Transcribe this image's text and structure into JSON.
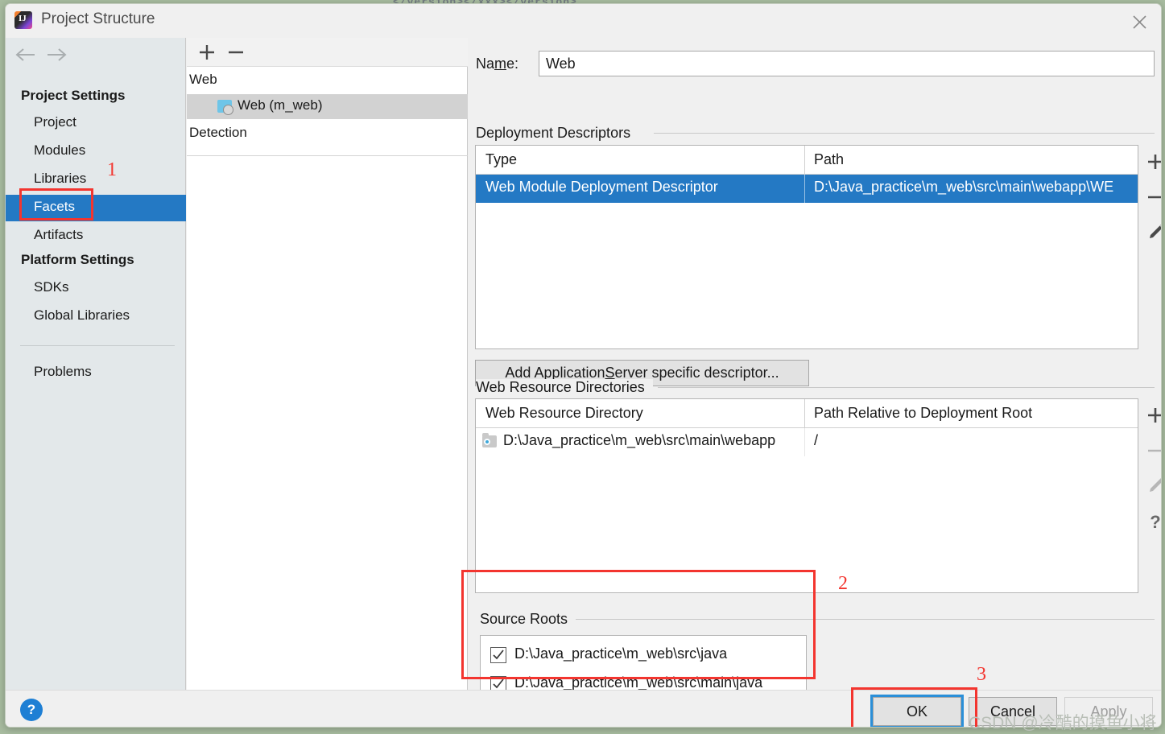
{
  "backdrop": {
    "code_fragment": "</version></xxx></version>"
  },
  "titlebar": {
    "title": "Project Structure",
    "app_icon": "intellij-idea-icon",
    "app_icon_letters": "IJ",
    "close_icon": "close-icon"
  },
  "sidebar": {
    "back_icon": "arrow-left-icon",
    "forward_icon": "arrow-right-icon",
    "groups": [
      {
        "label": "Project Settings"
      },
      {
        "label": "Platform Settings"
      }
    ],
    "items": [
      {
        "label": "Project",
        "selected": false
      },
      {
        "label": "Modules",
        "selected": false
      },
      {
        "label": "Libraries",
        "selected": false
      },
      {
        "label": "Facets",
        "selected": true
      },
      {
        "label": "Artifacts",
        "selected": false
      },
      {
        "label": "SDKs",
        "selected": false
      },
      {
        "label": "Global Libraries",
        "selected": false
      },
      {
        "label": "Problems",
        "selected": false
      }
    ]
  },
  "tree": {
    "add_icon": "plus-icon",
    "remove_icon": "minus-icon",
    "rows": [
      {
        "label": "Web",
        "selected": false
      },
      {
        "label": "Web (m_web)",
        "selected": true
      },
      {
        "label": "Detection",
        "selected": false
      }
    ],
    "facet_icon": "web-facet-icon"
  },
  "content": {
    "name_label_pre": "Na",
    "name_label_mnemonic": "m",
    "name_label_post": "e:",
    "name_value": "Web",
    "name_placeholder": "",
    "deployment_descriptors": {
      "caption": "Deployment Descriptors",
      "columns": [
        "Type",
        "Path"
      ],
      "rows": [
        {
          "type": "Web Module Deployment Descriptor",
          "path": "D:\\Java_practice\\m_web\\src\\main\\webapp\\WE",
          "selected": true
        }
      ],
      "toolbar": [
        {
          "icon": "plus-icon",
          "enabled": true
        },
        {
          "icon": "minus-icon",
          "enabled": true
        },
        {
          "icon": "pencil-icon",
          "enabled": true
        }
      ]
    },
    "add_descriptor_button": {
      "pre": "Add Application ",
      "mnemonic": "S",
      "post": "erver specific descriptor..."
    },
    "web_resource_directories": {
      "caption": "Web Resource Directories",
      "columns": [
        "Web Resource Directory",
        "Path Relative to Deployment Root"
      ],
      "rows": [
        {
          "directory": "D:\\Java_practice\\m_web\\src\\main\\webapp",
          "relative": "/",
          "icon": "folder-icon"
        }
      ],
      "toolbar": [
        {
          "icon": "plus-icon",
          "enabled": true
        },
        {
          "icon": "minus-icon",
          "enabled": false
        },
        {
          "icon": "pencil-icon",
          "enabled": false
        },
        {
          "icon": "question-icon",
          "enabled": true
        }
      ]
    },
    "source_roots": {
      "caption": "Source Roots",
      "rows": [
        {
          "label": "D:\\Java_practice\\m_web\\src\\java",
          "checked": true
        },
        {
          "label": "D:\\Java_practice\\m_web\\src\\main\\java",
          "checked": true
        }
      ]
    }
  },
  "footer": {
    "help_icon": "help-icon",
    "help_glyph": "?",
    "ok_label": "OK",
    "cancel_label": "Cancel",
    "apply_label": "Apply"
  },
  "annotations": [
    {
      "number": "1"
    },
    {
      "number": "2"
    },
    {
      "number": "3"
    }
  ],
  "watermark": "CSDN @冷酷的摸鱼小将",
  "colors": {
    "selection_blue": "#2479c4",
    "annotation_red": "#f3352f",
    "focus_blue": "#2b8fd8",
    "help_blue": "#1e7fd4",
    "dialog_bg": "#f0f0f0",
    "sidebar_bg": "#e3e8ea",
    "outer_bg": "#a8bca0"
  }
}
